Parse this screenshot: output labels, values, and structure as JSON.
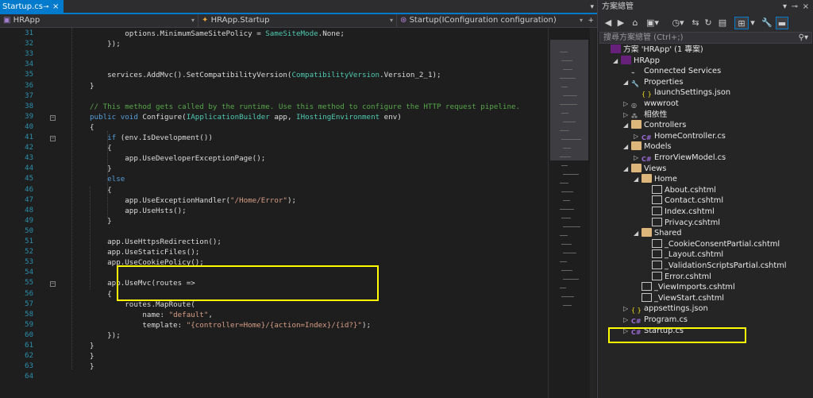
{
  "editor": {
    "tab": {
      "label": "Startup.cs",
      "pin": "⊸",
      "close": "×"
    },
    "nav": {
      "project": "HRApp",
      "type": "HRApp.Startup",
      "member": "Startup(IConfiguration configuration)"
    },
    "lines": [
      {
        "n": "31",
        "parts": [
          [
            "id",
            "        options.MinimumSameSitePolicy = "
          ],
          [
            "ty",
            "SameSiteMode"
          ],
          [
            "id",
            ".None;"
          ]
        ]
      },
      {
        "n": "32",
        "parts": [
          [
            "id",
            "    });"
          ]
        ]
      },
      {
        "n": "33",
        "parts": []
      },
      {
        "n": "34",
        "parts": []
      },
      {
        "n": "35",
        "parts": [
          [
            "id",
            "    services.AddMvc().SetCompatibilityVersion("
          ],
          [
            "ty",
            "CompatibilityVersion"
          ],
          [
            "id",
            ".Version_2_1);"
          ]
        ]
      },
      {
        "n": "36",
        "parts": [
          [
            "id",
            "}"
          ]
        ]
      },
      {
        "n": "37",
        "parts": []
      },
      {
        "n": "38",
        "parts": [
          [
            "cm",
            "// This method gets called by the runtime. Use this method to configure the HTTP request pipeline."
          ]
        ]
      },
      {
        "n": "39",
        "parts": [
          [
            "kw",
            "public void"
          ],
          [
            "id",
            " Configure("
          ],
          [
            "ty",
            "IApplicationBuilder"
          ],
          [
            "id",
            " app, "
          ],
          [
            "ty",
            "IHostingEnvironment"
          ],
          [
            "id",
            " env)"
          ]
        ]
      },
      {
        "n": "40",
        "parts": [
          [
            "id",
            "{"
          ]
        ]
      },
      {
        "n": "41",
        "parts": [
          [
            "kw",
            "    if"
          ],
          [
            "id",
            " (env.IsDevelopment())"
          ]
        ]
      },
      {
        "n": "42",
        "parts": [
          [
            "id",
            "    {"
          ]
        ]
      },
      {
        "n": "43",
        "parts": [
          [
            "id",
            "        app.UseDeveloperExceptionPage();"
          ]
        ]
      },
      {
        "n": "44",
        "parts": [
          [
            "id",
            "    }"
          ]
        ]
      },
      {
        "n": "45",
        "parts": [
          [
            "kw",
            "    else"
          ]
        ]
      },
      {
        "n": "46",
        "parts": [
          [
            "id",
            "    {"
          ]
        ]
      },
      {
        "n": "47",
        "parts": [
          [
            "id",
            "        app.UseExceptionHandler("
          ],
          [
            "st",
            "\"/Home/Error\""
          ],
          [
            "id",
            ");"
          ]
        ]
      },
      {
        "n": "48",
        "parts": [
          [
            "id",
            "        app.UseHsts();"
          ]
        ]
      },
      {
        "n": "49",
        "parts": [
          [
            "id",
            "    }"
          ]
        ]
      },
      {
        "n": "50",
        "parts": []
      },
      {
        "n": "51",
        "parts": [
          [
            "id",
            "    app.UseHttpsRedirection();"
          ]
        ]
      },
      {
        "n": "52",
        "parts": [
          [
            "id",
            "    app.UseStaticFiles();"
          ]
        ]
      },
      {
        "n": "53",
        "parts": [
          [
            "id",
            "    app.UseCookiePolicy();"
          ]
        ]
      },
      {
        "n": "54",
        "parts": []
      },
      {
        "n": "55",
        "parts": [
          [
            "id",
            "    app.UseMvc(routes =>"
          ]
        ]
      },
      {
        "n": "56",
        "parts": [
          [
            "id",
            "    {"
          ]
        ]
      },
      {
        "n": "57",
        "parts": [
          [
            "id",
            "        routes.MapRoute("
          ]
        ]
      },
      {
        "n": "58",
        "parts": [
          [
            "id",
            "            name: "
          ],
          [
            "st",
            "\"default\""
          ],
          [
            "id",
            ","
          ]
        ]
      },
      {
        "n": "59",
        "parts": [
          [
            "id",
            "            template: "
          ],
          [
            "st",
            "\"{controller=Home}/{action=Index}/{id?}\""
          ],
          [
            "id",
            ");"
          ]
        ]
      },
      {
        "n": "60",
        "parts": [
          [
            "id",
            "    });"
          ]
        ]
      },
      {
        "n": "61",
        "parts": [
          [
            "id",
            "}"
          ]
        ]
      },
      {
        "n": "62",
        "parts": [
          [
            "id",
            "}"
          ]
        ]
      },
      {
        "n": "63",
        "parts": [
          [
            "id",
            "}"
          ]
        ]
      },
      {
        "n": "64",
        "parts": []
      }
    ]
  },
  "solution": {
    "title": "方案總管",
    "search_placeholder": "搜尋方案總管 (Ctrl+;)",
    "tree": [
      {
        "label": "方案 'HRApp' (1 專案)",
        "depth": 0,
        "twist": "",
        "icon": "solution-icon"
      },
      {
        "label": "HRApp",
        "depth": 1,
        "twist": "◢",
        "icon": "project-icon"
      },
      {
        "label": "Connected Services",
        "depth": 2,
        "twist": "",
        "icon": "connected-services-icon"
      },
      {
        "label": "Properties",
        "depth": 2,
        "twist": "◢",
        "icon": "wrench-icon"
      },
      {
        "label": "launchSettings.json",
        "depth": 3,
        "twist": "",
        "icon": "json-icon"
      },
      {
        "label": "wwwroot",
        "depth": 2,
        "twist": "▷",
        "icon": "globe-icon"
      },
      {
        "label": "相依性",
        "depth": 2,
        "twist": "▷",
        "icon": "dependencies-icon"
      },
      {
        "label": "Controllers",
        "depth": 2,
        "twist": "◢",
        "icon": "folder-icon"
      },
      {
        "label": "HomeController.cs",
        "depth": 3,
        "twist": "▷",
        "icon": "csharp-file-icon"
      },
      {
        "label": "Models",
        "depth": 2,
        "twist": "◢",
        "icon": "folder-icon"
      },
      {
        "label": "ErrorViewModel.cs",
        "depth": 3,
        "twist": "▷",
        "icon": "csharp-file-icon"
      },
      {
        "label": "Views",
        "depth": 2,
        "twist": "◢",
        "icon": "folder-icon"
      },
      {
        "label": "Home",
        "depth": 3,
        "twist": "◢",
        "icon": "folder-icon"
      },
      {
        "label": "About.cshtml",
        "depth": 4,
        "twist": "",
        "icon": "cshtml-file-icon"
      },
      {
        "label": "Contact.cshtml",
        "depth": 4,
        "twist": "",
        "icon": "cshtml-file-icon"
      },
      {
        "label": "Index.cshtml",
        "depth": 4,
        "twist": "",
        "icon": "cshtml-file-icon"
      },
      {
        "label": "Privacy.cshtml",
        "depth": 4,
        "twist": "",
        "icon": "cshtml-file-icon"
      },
      {
        "label": "Shared",
        "depth": 3,
        "twist": "◢",
        "icon": "folder-icon"
      },
      {
        "label": "_CookieConsentPartial.cshtml",
        "depth": 4,
        "twist": "",
        "icon": "cshtml-file-icon"
      },
      {
        "label": "_Layout.cshtml",
        "depth": 4,
        "twist": "",
        "icon": "cshtml-file-icon"
      },
      {
        "label": "_ValidationScriptsPartial.cshtml",
        "depth": 4,
        "twist": "",
        "icon": "cshtml-file-icon"
      },
      {
        "label": "Error.cshtml",
        "depth": 4,
        "twist": "",
        "icon": "cshtml-file-icon"
      },
      {
        "label": "_ViewImports.cshtml",
        "depth": 3,
        "twist": "",
        "icon": "cshtml-file-icon"
      },
      {
        "label": "_ViewStart.cshtml",
        "depth": 3,
        "twist": "",
        "icon": "cshtml-file-icon"
      },
      {
        "label": "appsettings.json",
        "depth": 2,
        "twist": "▷",
        "icon": "json-icon"
      },
      {
        "label": "Program.cs",
        "depth": 2,
        "twist": "▷",
        "icon": "csharp-file-icon"
      },
      {
        "label": "Startup.cs",
        "depth": 2,
        "twist": "▷",
        "icon": "csharp-file-icon"
      }
    ]
  },
  "colors": {
    "accent": "#007acc",
    "highlight": "#ffff00"
  }
}
